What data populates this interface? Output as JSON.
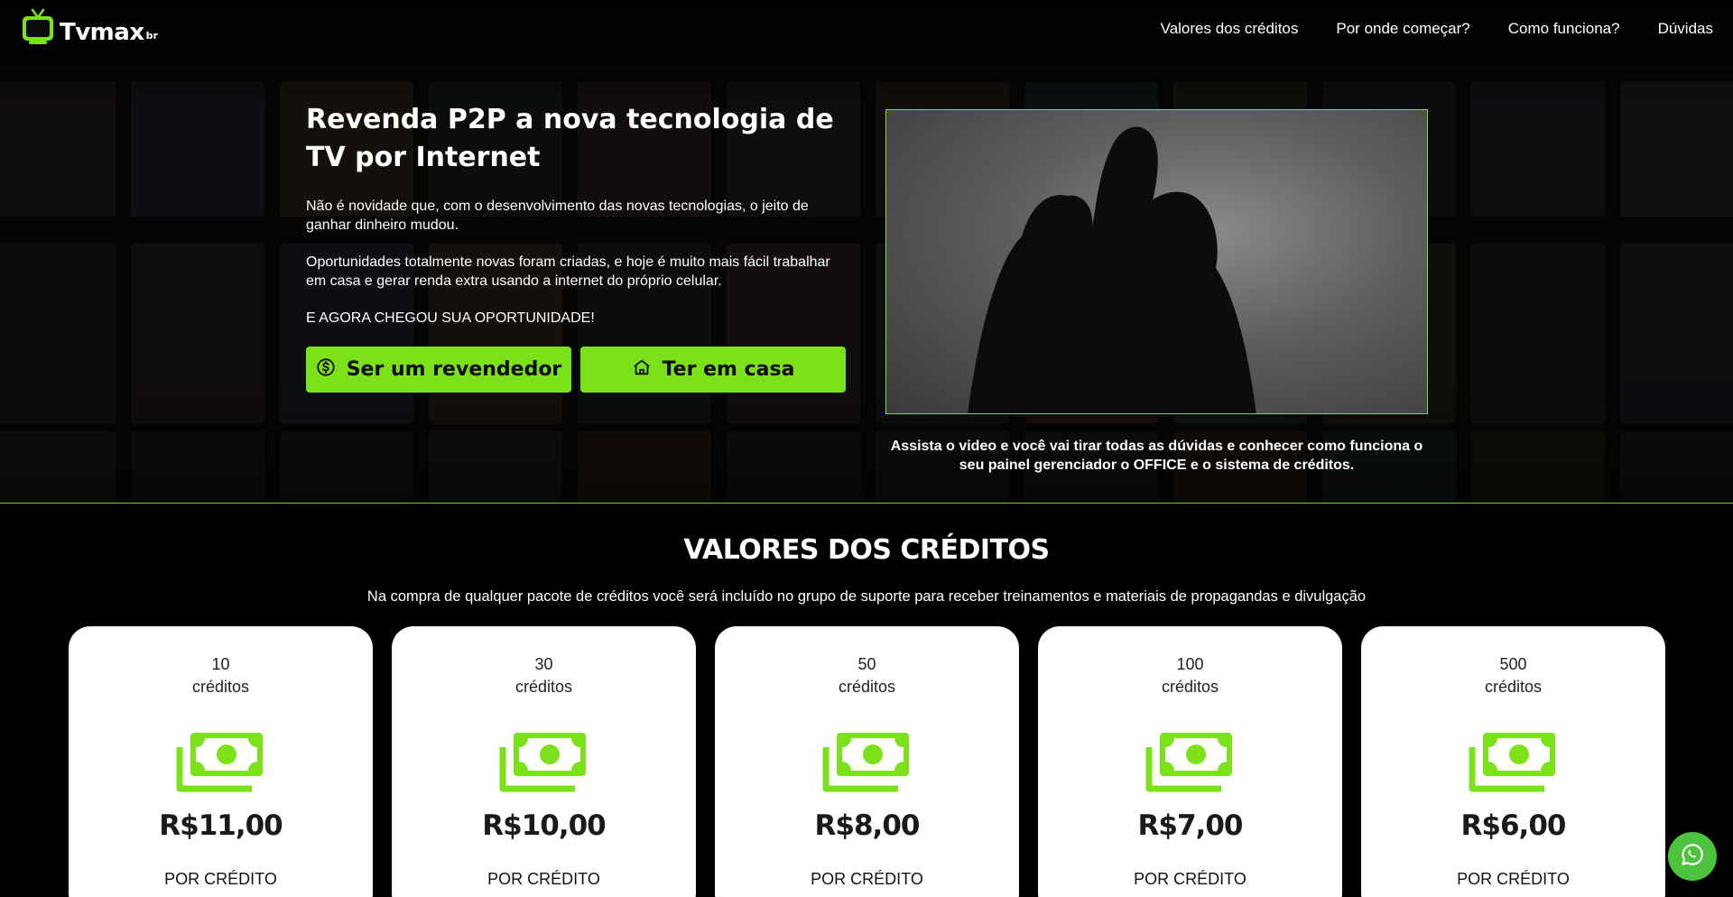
{
  "brand": {
    "name": "Tvmax",
    "suffix": "br",
    "accent": "#7be21a"
  },
  "nav": [
    {
      "label": "Valores dos créditos"
    },
    {
      "label": "Por onde começar?"
    },
    {
      "label": "Como funciona?"
    },
    {
      "label": "Dúvidas"
    }
  ],
  "hero": {
    "title": "Revenda P2P a nova tecnologia de TV por Internet",
    "p1": "Não é novidade que, com o desenvolvimento das novas tecnologias, o jeito de ganhar dinheiro mudou.",
    "p2": "Oportunidades totalmente novas foram criadas, e hoje é muito mais fácil trabalhar em casa e gerar renda extra usando a internet do próprio celular.",
    "p3": "E AGORA CHEGOU SUA OPORTUNIDADE!",
    "btn_reseller": "Ser um revendedor",
    "btn_home": "Ter em casa",
    "video_caption": "Assista o video e você vai tirar todas as dúvidas e conhecer como funciona o seu painel gerenciador o OFFICE e o sistema de créditos."
  },
  "credits": {
    "title": "VALORES DOS CRÉDITOS",
    "subtitle": "Na compra de qualquer pacote de créditos você será incluído no grupo de suporte para receber treinamentos e materiais de propagandas e divulgação",
    "unit_word": "créditos",
    "per_credit": "POR CRÉDITO",
    "packages": [
      {
        "qty": "10",
        "price": "R$11,00"
      },
      {
        "qty": "30",
        "price": "R$10,00"
      },
      {
        "qty": "50",
        "price": "R$8,00"
      },
      {
        "qty": "100",
        "price": "R$7,00"
      },
      {
        "qty": "500",
        "price": "R$6,00"
      }
    ]
  }
}
